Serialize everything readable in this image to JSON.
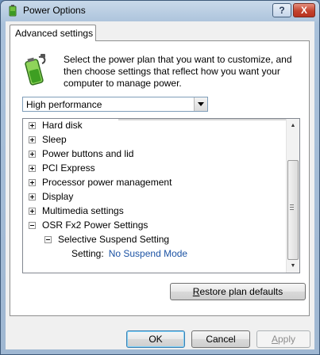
{
  "window": {
    "title": "Power Options",
    "help_label": "?",
    "close_label": "X"
  },
  "tab": {
    "label": "Advanced settings"
  },
  "description": "Select the power plan that you want to customize, and then choose settings that reflect how you want your computer to manage power.",
  "plan_select": {
    "value": "High performance"
  },
  "tree": {
    "items": [
      {
        "label": "Hard disk",
        "expander": "plus"
      },
      {
        "label": "Sleep",
        "expander": "plus"
      },
      {
        "label": "Power buttons and lid",
        "expander": "plus"
      },
      {
        "label": "PCI Express",
        "expander": "plus"
      },
      {
        "label": "Processor power management",
        "expander": "plus"
      },
      {
        "label": "Display",
        "expander": "plus"
      },
      {
        "label": "Multimedia settings",
        "expander": "plus"
      },
      {
        "label": "OSR Fx2 Power Settings",
        "expander": "minus"
      },
      {
        "label": "Selective Suspend Setting",
        "expander": "minus"
      },
      {
        "label": "Setting:",
        "value": "No Suspend Mode"
      }
    ]
  },
  "buttons": {
    "restore_prefix": "R",
    "restore_rest": "estore plan defaults",
    "ok": "OK",
    "cancel": "Cancel",
    "apply_prefix": "A",
    "apply_rest": "pply"
  },
  "colors": {
    "accent_link": "#1c53a4",
    "close_red": "#c3432d"
  },
  "icons": {
    "title": "power-options-icon",
    "battery": "battery-plug-icon"
  }
}
